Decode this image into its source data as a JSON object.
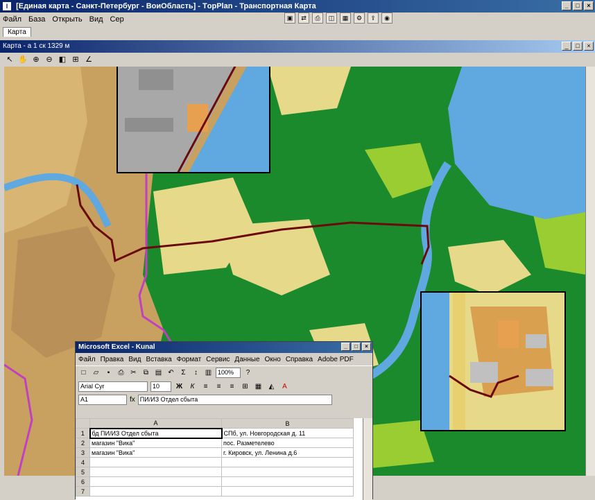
{
  "window": {
    "title": "[Единая карта - Санкт-Петербург - ВоиОбласть] - ТopPlan - Транспортная Карта",
    "icon_letter": "I"
  },
  "menu": [
    "Файл",
    "База",
    "Открыть",
    "Вид",
    "Сер"
  ],
  "tab": "Карта",
  "map_window": {
    "title": "Карта - а 1 ск 1329 м"
  },
  "map_toolbar": [
    "pointer-icon",
    "hand-icon",
    "zoom-in-icon",
    "zoom-out-icon",
    "select-icon",
    "measure-icon",
    "angle-icon"
  ],
  "colors": {
    "water": "#5fa8e0",
    "forest": "#1a8a2c",
    "field": "#e6d98a",
    "city": "#c8a060",
    "route": "#6a0a0a",
    "boundary": "#c040c0"
  },
  "excel": {
    "title": "Microsoft Excel - Kunal",
    "menu": [
      "Файл",
      "Правка",
      "Вид",
      "Вставка",
      "Формат",
      "Сервис",
      "Данные",
      "Окно",
      "Справка",
      "Adobe PDF"
    ],
    "font_name": "Arial Cyr",
    "font_size": "10",
    "zoom": "100%",
    "cell_ref": "A1",
    "formula_label": "fx",
    "formula_value": "ПИ/ИЗ Отдел сбыта",
    "columns": [
      "A",
      "B"
    ],
    "rows": [
      {
        "n": "1",
        "a": "бд ПИ/ИЗ Отдел сбыта",
        "b": "СПб, ул. Новгородская д. 11"
      },
      {
        "n": "2",
        "a": "магазин \"Вика\"",
        "b": "пос. Разметелево"
      },
      {
        "n": "3",
        "a": "магазин \"Вика\"",
        "b": "г. Кировск, ул. Ленина д.6"
      },
      {
        "n": "4",
        "a": "",
        "b": ""
      },
      {
        "n": "5",
        "a": "",
        "b": ""
      },
      {
        "n": "6",
        "a": "",
        "b": ""
      },
      {
        "n": "7",
        "a": "",
        "b": ""
      }
    ]
  }
}
